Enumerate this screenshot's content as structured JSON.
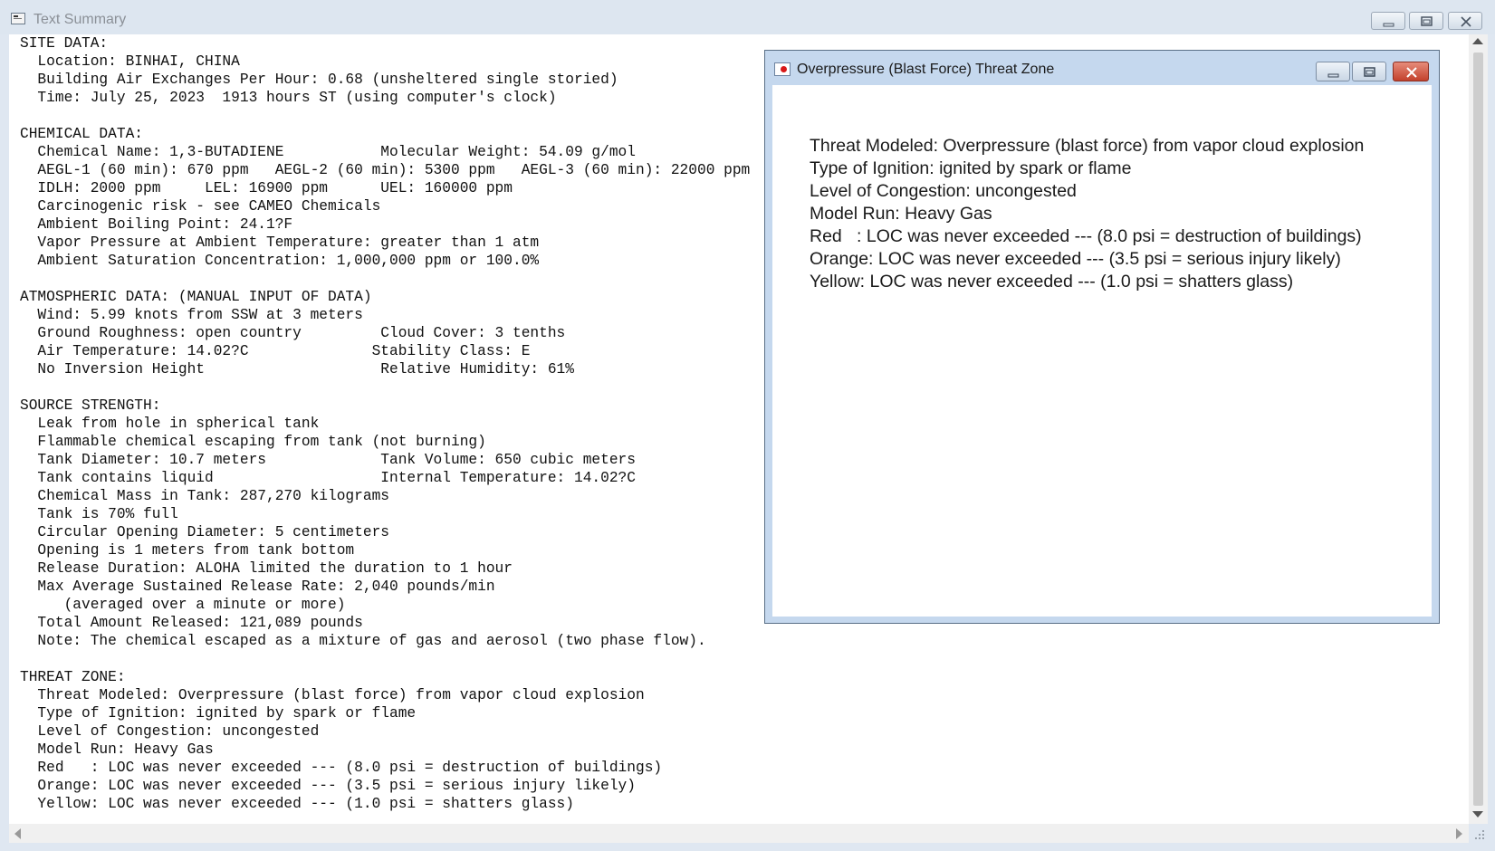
{
  "main_window": {
    "title": "Text Summary",
    "summary_text": "SITE DATA:\n  Location: BINHAI, CHINA\n  Building Air Exchanges Per Hour: 0.68 (unsheltered single storied)\n  Time: July 25, 2023  1913 hours ST (using computer's clock)\n\nCHEMICAL DATA:\n  Chemical Name: 1,3-BUTADIENE           Molecular Weight: 54.09 g/mol\n  AEGL-1 (60 min): 670 ppm   AEGL-2 (60 min): 5300 ppm   AEGL-3 (60 min): 22000 ppm\n  IDLH: 2000 ppm     LEL: 16900 ppm      UEL: 160000 ppm\n  Carcinogenic risk - see CAMEO Chemicals\n  Ambient Boiling Point: 24.1?F\n  Vapor Pressure at Ambient Temperature: greater than 1 atm\n  Ambient Saturation Concentration: 1,000,000 ppm or 100.0%\n\nATMOSPHERIC DATA: (MANUAL INPUT OF DATA)\n  Wind: 5.99 knots from SSW at 3 meters\n  Ground Roughness: open country         Cloud Cover: 3 tenths\n  Air Temperature: 14.02?C              Stability Class: E\n  No Inversion Height                    Relative Humidity: 61%\n\nSOURCE STRENGTH:\n  Leak from hole in spherical tank\n  Flammable chemical escaping from tank (not burning)\n  Tank Diameter: 10.7 meters             Tank Volume: 650 cubic meters\n  Tank contains liquid                   Internal Temperature: 14.02?C\n  Chemical Mass in Tank: 287,270 kilograms\n  Tank is 70% full\n  Circular Opening Diameter: 5 centimeters\n  Opening is 1 meters from tank bottom\n  Release Duration: ALOHA limited the duration to 1 hour\n  Max Average Sustained Release Rate: 2,040 pounds/min\n     (averaged over a minute or more)\n  Total Amount Released: 121,089 pounds\n  Note: The chemical escaped as a mixture of gas and aerosol (two phase flow).\n\nTHREAT ZONE:\n  Threat Modeled: Overpressure (blast force) from vapor cloud explosion\n  Type of Ignition: ignited by spark or flame\n  Level of Congestion: uncongested\n  Model Run: Heavy Gas\n  Red   : LOC was never exceeded --- (8.0 psi = destruction of buildings)\n  Orange: LOC was never exceeded --- (3.5 psi = serious injury likely)\n  Yellow: LOC was never exceeded --- (1.0 psi = shatters glass)"
  },
  "threat_window": {
    "title": "Overpressure (Blast Force) Threat Zone",
    "lines": [
      "Threat Modeled: Overpressure (blast force) from vapor cloud explosion",
      "Type of Ignition: ignited by spark or flame",
      "Level of Congestion: uncongested",
      "Model Run: Heavy Gas",
      "Red   : LOC was never exceeded --- (8.0 psi = destruction of buildings)",
      "Orange: LOC was never exceeded --- (3.5 psi = serious injury likely)",
      "Yellow: LOC was never exceeded --- (1.0 psi = shatters glass)"
    ]
  },
  "icons": {
    "main_app": "text-document-icon",
    "threat_app": "red-dot-map-icon",
    "minimize": "minimize-icon",
    "maximize": "maximize-icon",
    "close": "close-icon"
  },
  "colors": {
    "main_frame": "#dfe7f1",
    "dialog_frame": "#c5d8ee",
    "close_button": "#c3412c"
  }
}
